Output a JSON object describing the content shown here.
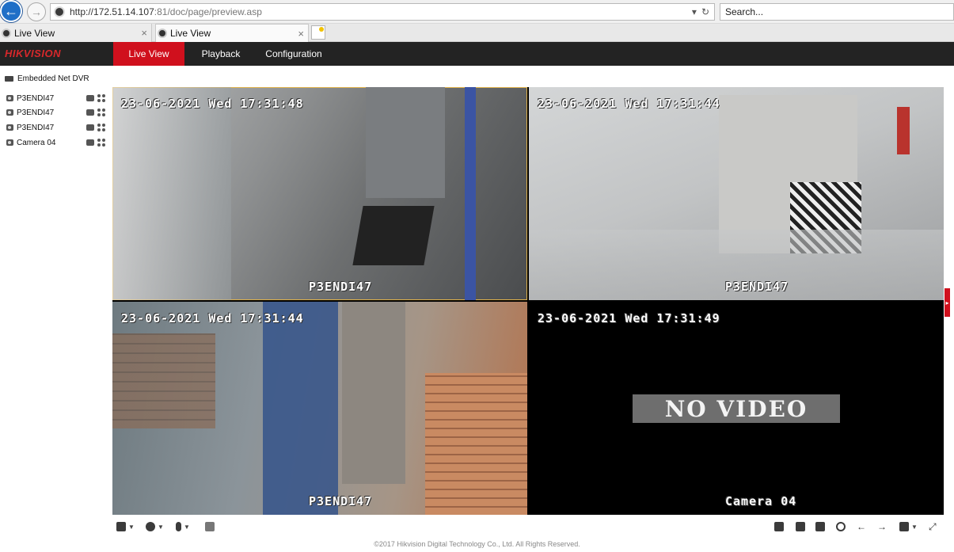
{
  "browser": {
    "url_host": "http://172.51.14.107",
    "url_rest": ":81/doc/page/preview.asp",
    "search_placeholder": "Search...",
    "tabs": [
      {
        "label": "Live View"
      },
      {
        "label": "Live View"
      }
    ],
    "tab_close": "×"
  },
  "app": {
    "logo": "HIKVISION",
    "nav": [
      {
        "label": "Live View",
        "active": true
      },
      {
        "label": "Playback",
        "active": false
      },
      {
        "label": "Configuration",
        "active": false
      }
    ],
    "accent_color": "#d0101d"
  },
  "device_tree": {
    "root": "Embedded Net DVR",
    "cameras": [
      {
        "name": "P3ENDI47"
      },
      {
        "name": "P3ENDI47"
      },
      {
        "name": "P3ENDI47"
      },
      {
        "name": "Camera 04"
      }
    ]
  },
  "video_tiles": [
    {
      "timestamp": "23-06-2021  Wed  17:31:48",
      "name": "P3ENDI47",
      "selected": true
    },
    {
      "timestamp": "23-06-2021  Wed  17:31:44",
      "name": "P3ENDI47",
      "selected": false
    },
    {
      "timestamp": "23-06-2021  Wed  17:31:44",
      "name": "P3ENDI47",
      "selected": false
    },
    {
      "timestamp": "23-06-2021  Wed  17:31:49",
      "name": "Camera 04",
      "selected": false,
      "no_video": "NO VIDEO"
    }
  ],
  "toolbar": {
    "left": [
      "layout-icon",
      "ptz-icon",
      "microphone-icon",
      "stream-icon"
    ],
    "right": [
      "stop-all-icon",
      "capture-icon",
      "record-icon",
      "zoom-icon",
      "prev-icon",
      "next-icon",
      "volume-icon",
      "fullscreen-icon"
    ]
  },
  "footer": "©2017 Hikvision Digital Technology Co., Ltd. All Rights Reserved."
}
